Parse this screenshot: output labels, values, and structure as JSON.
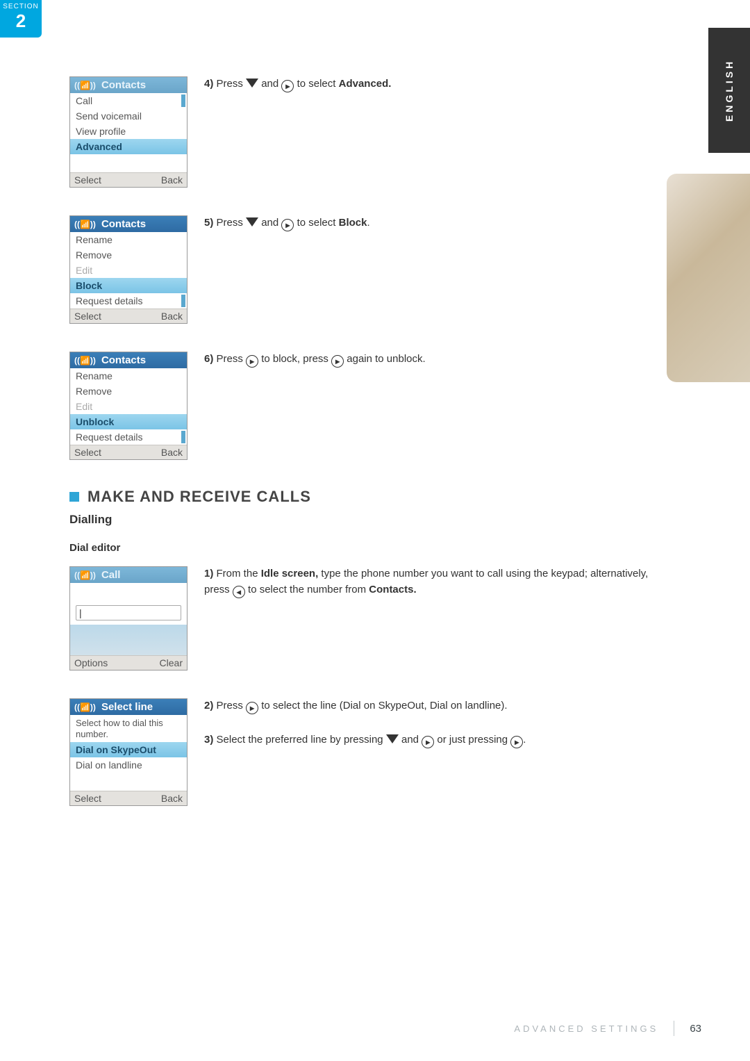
{
  "section": {
    "label": "SECTION",
    "number": "2"
  },
  "language": "ENGLISH",
  "steps": {
    "s4": {
      "num": "4)",
      "prefix": "Press ",
      "mid": " and ",
      "suffix": " to select ",
      "target": "Advanced."
    },
    "s5": {
      "num": "5)",
      "prefix": "Press ",
      "mid": " and ",
      "suffix": " to select ",
      "target": "Block",
      "period": "."
    },
    "s6": {
      "num": "6)",
      "prefix": "Press ",
      "mid": " to block, press ",
      "suffix": " again to unblock."
    },
    "d1": {
      "num": "1)",
      "prefix": "From the ",
      "idle": "Idle screen,",
      "mid": " type the phone number you want to call using the keypad; alternatively, press ",
      "suffix": " to select the number from ",
      "contacts": "Contacts."
    },
    "d2": {
      "num": "2)",
      "prefix": "Press ",
      "suffix": " to select the line (Dial on SkypeOut, Dial on landline)."
    },
    "d3": {
      "num": "3)",
      "prefix": "Select the preferred line by pressing ",
      "mid": " and ",
      "or": " or just pressing ",
      "period": "."
    }
  },
  "phones": {
    "p4": {
      "title": "Contacts",
      "items": [
        "Call",
        "Send voicemail",
        "View profile",
        "Advanced"
      ],
      "selectedIndex": 3,
      "scrollIndex": 0,
      "soft": [
        "Select",
        "Back"
      ]
    },
    "p5": {
      "title": "Contacts",
      "items": [
        "Rename",
        "Remove",
        "Edit",
        "Block",
        "Request details"
      ],
      "selectedIndex": 3,
      "disabledIndex": 2,
      "scrollIndex": 4,
      "soft": [
        "Select",
        "Back"
      ]
    },
    "p6": {
      "title": "Contacts",
      "items": [
        "Rename",
        "Remove",
        "Edit",
        "Unblock",
        "Request details"
      ],
      "selectedIndex": 3,
      "disabledIndex": 2,
      "scrollIndex": 4,
      "soft": [
        "Select",
        "Back"
      ]
    },
    "call": {
      "title": "Call",
      "input": "|",
      "soft": [
        "Options",
        "Clear"
      ]
    },
    "selectline": {
      "title": "Select line",
      "help": "Select how to dial this number.",
      "items": [
        "Dial on SkypeOut",
        "Dial on landline"
      ],
      "selectedIndex": 0,
      "soft": [
        "Select",
        "Back"
      ]
    }
  },
  "icons": {
    "enter": "▸",
    "left": "◂"
  },
  "headings": {
    "make": "MAKE AND RECEIVE CALLS",
    "dialling": "Dialling",
    "dialeditor": "Dial editor"
  },
  "footer": {
    "section": "ADVANCED SETTINGS",
    "page": "63"
  }
}
